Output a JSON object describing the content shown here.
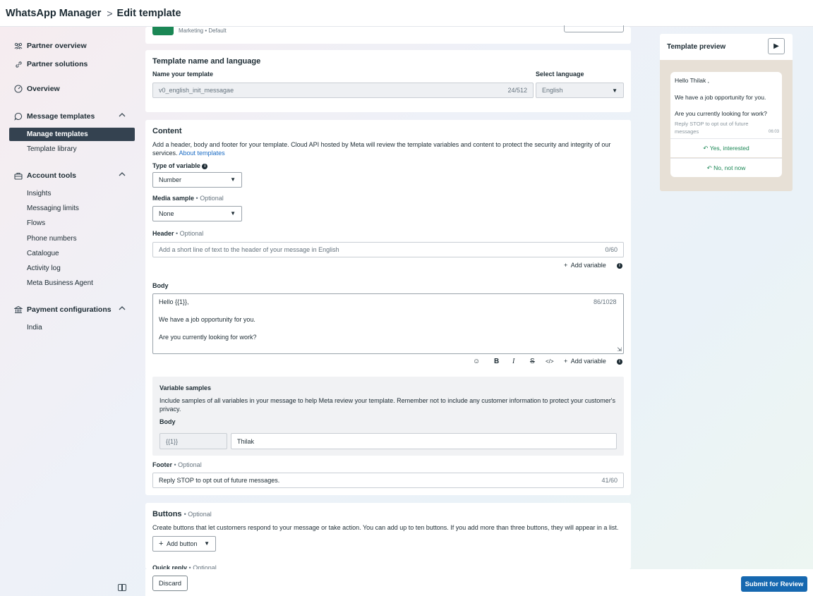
{
  "header": {
    "app_name": "WhatsApp Manager",
    "separator": ">",
    "page_title": "Edit template"
  },
  "sidebar": {
    "partner_overview": "Partner overview",
    "partner_solutions": "Partner solutions",
    "overview": "Overview",
    "message_templates": "Message templates",
    "manage_templates": "Manage templates",
    "template_library": "Template library",
    "account_tools": "Account tools",
    "insights": "Insights",
    "messaging_limits": "Messaging limits",
    "flows": "Flows",
    "phone_numbers": "Phone numbers",
    "catalogue": "Catalogue",
    "activity_log": "Activity log",
    "meta_business_agent": "Meta Business Agent",
    "payment_configurations": "Payment configurations",
    "india": "India"
  },
  "template_meta": {
    "category": "Marketing",
    "type": "• Default"
  },
  "name_language": {
    "title": "Template name and language",
    "name_label": "Name your template",
    "name_value": "v0_english_init_messagae",
    "name_count": "24/512",
    "language_label": "Select language",
    "language_value": "English"
  },
  "content": {
    "title": "Content",
    "description": "Add a header, body and footer for your template. Cloud API hosted by Meta will review the template variables and content to protect the security and integrity of our services.",
    "about_link": "About templates",
    "type_of_variable_label": "Type of variable",
    "type_of_variable_value": "Number",
    "media_sample_label": "Media sample",
    "optional": "• Optional",
    "media_sample_value": "None",
    "header_label": "Header",
    "header_placeholder": "Add a short line of text to the header of your message in English",
    "header_count": "0/60",
    "add_variable": "Add variable",
    "body_label": "Body",
    "body_line1": "Hello {{1}},",
    "body_line2": "We have a job opportunity for you.",
    "body_line3": "Are you currently looking for work?",
    "body_count": "86/1028",
    "variable_samples_title": "Variable samples",
    "variable_samples_desc": "Include samples of all variables in your message to help Meta review your template. Remember not to include any customer information to protect your customer's privacy.",
    "variable_body_label": "Body",
    "variable_token": "{{1}}",
    "variable_value": "Thilak",
    "footer_label": "Footer",
    "footer_value": "Reply STOP to opt out of future messages.",
    "footer_count": "41/60"
  },
  "buttons_section": {
    "title": "Buttons",
    "optional": "• Optional",
    "description": "Create buttons that let customers respond to your message or take action. You can add up to ten buttons. If you add more than three buttons, they will appear in a list.",
    "add_button": "Add button",
    "quick_reply_label": "Quick reply",
    "quick_reply_optional": "• Optional"
  },
  "preview": {
    "title": "Template preview",
    "greeting": "Hello Thilak ,",
    "line2": "We have a job opportunity for you.",
    "line3": "Are you currently looking for work?",
    "footer": "Reply STOP to opt out of future messages",
    "time": "06:03",
    "reply1": "Yes, interested",
    "reply2": "No, not now"
  },
  "actions": {
    "discard": "Discard",
    "submit": "Submit for Review"
  },
  "colors": {
    "accent": "#1668b0",
    "sidebar_active": "#344250",
    "whatsapp_green": "#1b8755"
  }
}
